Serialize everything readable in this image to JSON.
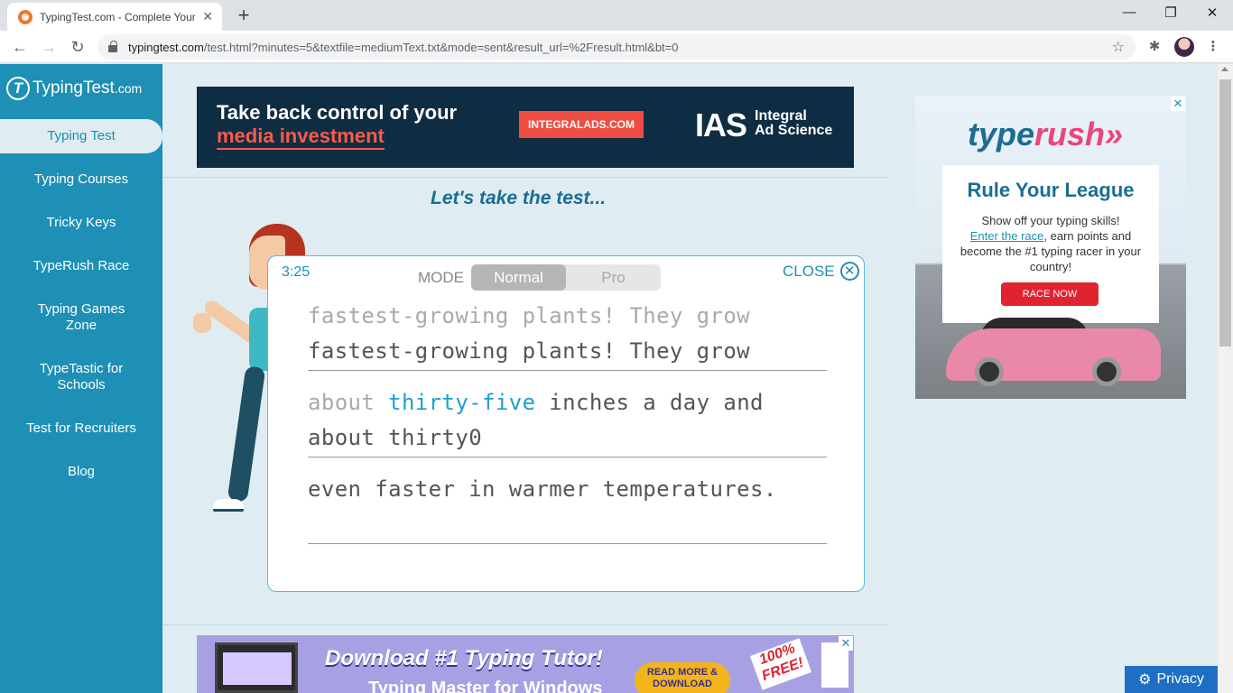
{
  "browser": {
    "tab_title": "TypingTest.com - Complete Your",
    "tab_close": "✕",
    "new_tab": "+",
    "window_controls": {
      "minimize": "—",
      "maximize": "❐",
      "close": "✕"
    },
    "nav": {
      "back": "←",
      "forward": "→",
      "reload": "↻"
    },
    "url_host": "typingtest.com",
    "url_path": "/test.html?minutes=5&textfile=mediumText.txt&mode=sent&result_url=%2Fresult.html&bt=0",
    "bookmark_star": "☆",
    "extensions_icon": "✱",
    "menu_icon": "⋮"
  },
  "sidebar": {
    "logo_main": "TypingTest",
    "logo_suffix": ".com",
    "items": [
      {
        "label": "Typing Test",
        "active": true
      },
      {
        "label": "Typing Courses"
      },
      {
        "label": "Tricky Keys"
      },
      {
        "label": "TypeRush Race"
      },
      {
        "label": "Typing Games Zone"
      },
      {
        "label": "TypeTastic for Schools"
      },
      {
        "label": "Test for Recruiters"
      },
      {
        "label": "Blog"
      }
    ]
  },
  "top_ad": {
    "line1": "Take back control of your",
    "line2": "media investment",
    "button": "INTEGRALADS.COM",
    "brand": "IAS",
    "brand_sub1": "Integral",
    "brand_sub2": "Ad Science"
  },
  "main": {
    "heading": "Let's take the test..."
  },
  "test_panel": {
    "timer": "3:25",
    "mode_label": "MODE",
    "mode_options": [
      "Normal",
      "Pro"
    ],
    "mode_selected": "Normal",
    "close_label": "CLOSE",
    "close_icon": "✕",
    "line1_target": "fastest-growing plants! They grow",
    "line1_typed": "fastest-growing plants! They grow",
    "line2_done": "about ",
    "line2_current": "thirty-five",
    "line2_rest": " inches a day and",
    "line2_typed": "about thirty0",
    "line3_target": "even faster in warmer temperatures."
  },
  "side_ad": {
    "logo_a": "type",
    "logo_b": "rush»",
    "close": "✕",
    "title": "Rule Your League",
    "body_1": "Show off your typing skills!",
    "body_link": "Enter the race",
    "body_2": ", earn points and become the #1 typing racer in your country!",
    "button": "RACE NOW"
  },
  "bottom_ad": {
    "close": "✕",
    "headline": "Download #1 Typing Tutor!",
    "sub": "Typing Master for Windows",
    "button": "READ MORE & DOWNLOAD",
    "badge": "100% FREE!"
  },
  "privacy": {
    "icon": "⚙",
    "label": "Privacy"
  },
  "colors": {
    "sidebar_bg": "#1e8fb5",
    "accent": "#1e8fb5",
    "page_bg": "#dfecf1"
  }
}
